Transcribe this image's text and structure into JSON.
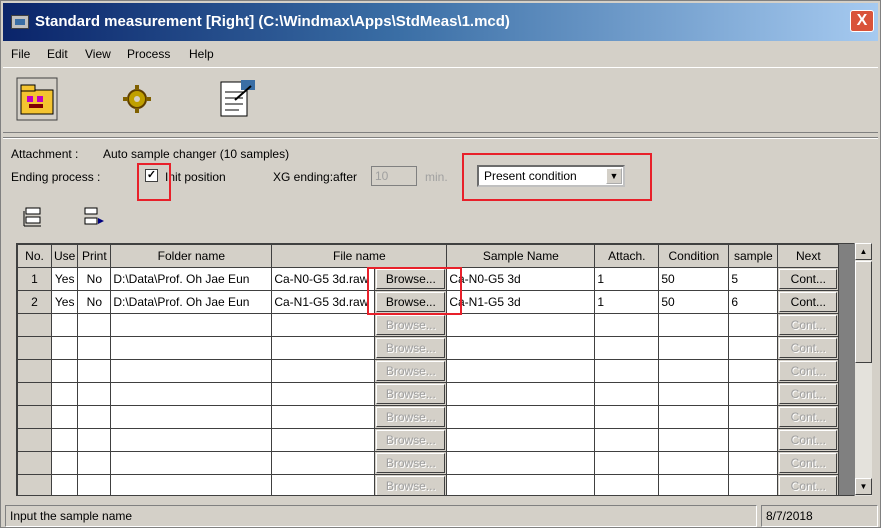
{
  "window": {
    "title": "Standard measurement [Right] (C:\\Windmax\\Apps\\StdMeas\\1.mcd)",
    "close": "X"
  },
  "menu": [
    {
      "label": "File"
    },
    {
      "label": "Edit"
    },
    {
      "label": "View"
    },
    {
      "label": "Process"
    },
    {
      "label": "Help"
    }
  ],
  "toolbar": {
    "icons": [
      "open-folder-icon",
      "settings-gear-icon",
      "document-edit-icon"
    ]
  },
  "attachment": {
    "label": "Attachment :",
    "value": "Auto sample changer (10 samples)"
  },
  "ending": {
    "label": "Ending process :",
    "checkbox_checked": true,
    "checkbox_mark": "✓",
    "checkbox_label": "Init position",
    "xg_label": "XG ending:after",
    "xg_value": "10",
    "xg_unit": "min.",
    "condition_selected": "Present condition"
  },
  "grid": {
    "columns": [
      "No.",
      "Use",
      "Print",
      "Folder name",
      "File name",
      "Sample Name",
      "Attach.",
      "Condition",
      "sample",
      "Next"
    ],
    "browse_label": "Browse...",
    "cont_label": "Cont...",
    "rows": [
      {
        "no": "1",
        "use": "Yes",
        "print": "No",
        "folder": "D:\\Data\\Prof. Oh Jae Eun",
        "file": "Ca-N0-G5 3d.raw",
        "sample_name": "Ca-N0-G5 3d",
        "attach": "1",
        "condition": "50",
        "sample": "5"
      },
      {
        "no": "2",
        "use": "Yes",
        "print": "No",
        "folder": "D:\\Data\\Prof. Oh Jae Eun",
        "file": "Ca-N1-G5 3d.raw",
        "sample_name": "Ca-N1-G5 3d",
        "attach": "1",
        "condition": "50",
        "sample": "6"
      },
      {
        "no": "",
        "use": "",
        "print": "",
        "folder": "",
        "file": "",
        "sample_name": "",
        "attach": "",
        "condition": "",
        "sample": ""
      },
      {
        "no": "",
        "use": "",
        "print": "",
        "folder": "",
        "file": "",
        "sample_name": "",
        "attach": "",
        "condition": "",
        "sample": ""
      },
      {
        "no": "",
        "use": "",
        "print": "",
        "folder": "",
        "file": "",
        "sample_name": "",
        "attach": "",
        "condition": "",
        "sample": ""
      },
      {
        "no": "",
        "use": "",
        "print": "",
        "folder": "",
        "file": "",
        "sample_name": "",
        "attach": "",
        "condition": "",
        "sample": ""
      },
      {
        "no": "",
        "use": "",
        "print": "",
        "folder": "",
        "file": "",
        "sample_name": "",
        "attach": "",
        "condition": "",
        "sample": ""
      },
      {
        "no": "",
        "use": "",
        "print": "",
        "folder": "",
        "file": "",
        "sample_name": "",
        "attach": "",
        "condition": "",
        "sample": ""
      },
      {
        "no": "",
        "use": "",
        "print": "",
        "folder": "",
        "file": "",
        "sample_name": "",
        "attach": "",
        "condition": "",
        "sample": ""
      },
      {
        "no": "",
        "use": "",
        "print": "",
        "folder": "",
        "file": "",
        "sample_name": "",
        "attach": "",
        "condition": "",
        "sample": ""
      }
    ]
  },
  "status": {
    "message": "Input the sample name",
    "date": "8/7/2018"
  },
  "colors": {
    "highlight_box": "#e8202a",
    "titlebar_start": "#0a246a"
  }
}
